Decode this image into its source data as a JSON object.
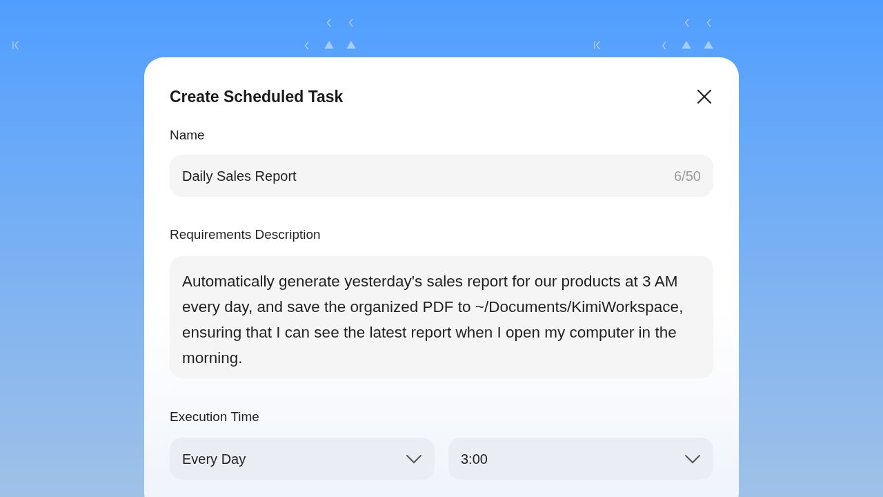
{
  "dialog": {
    "title": "Create Scheduled Task",
    "name_field": {
      "label": "Name",
      "value": "Daily Sales Report",
      "counter": "6/50"
    },
    "description_field": {
      "label": "Requirements Description",
      "value": "Automatically generate yesterday's sales report for our products at 3 AM every day, and save the organized PDF to ~/Documents/KimiWorkspace, ensuring that I can see the latest report when I open my computer in the morning."
    },
    "execution_time": {
      "label": "Execution Time",
      "selects": [
        {
          "value": "Every Day"
        },
        {
          "value": "3:00"
        }
      ]
    }
  }
}
